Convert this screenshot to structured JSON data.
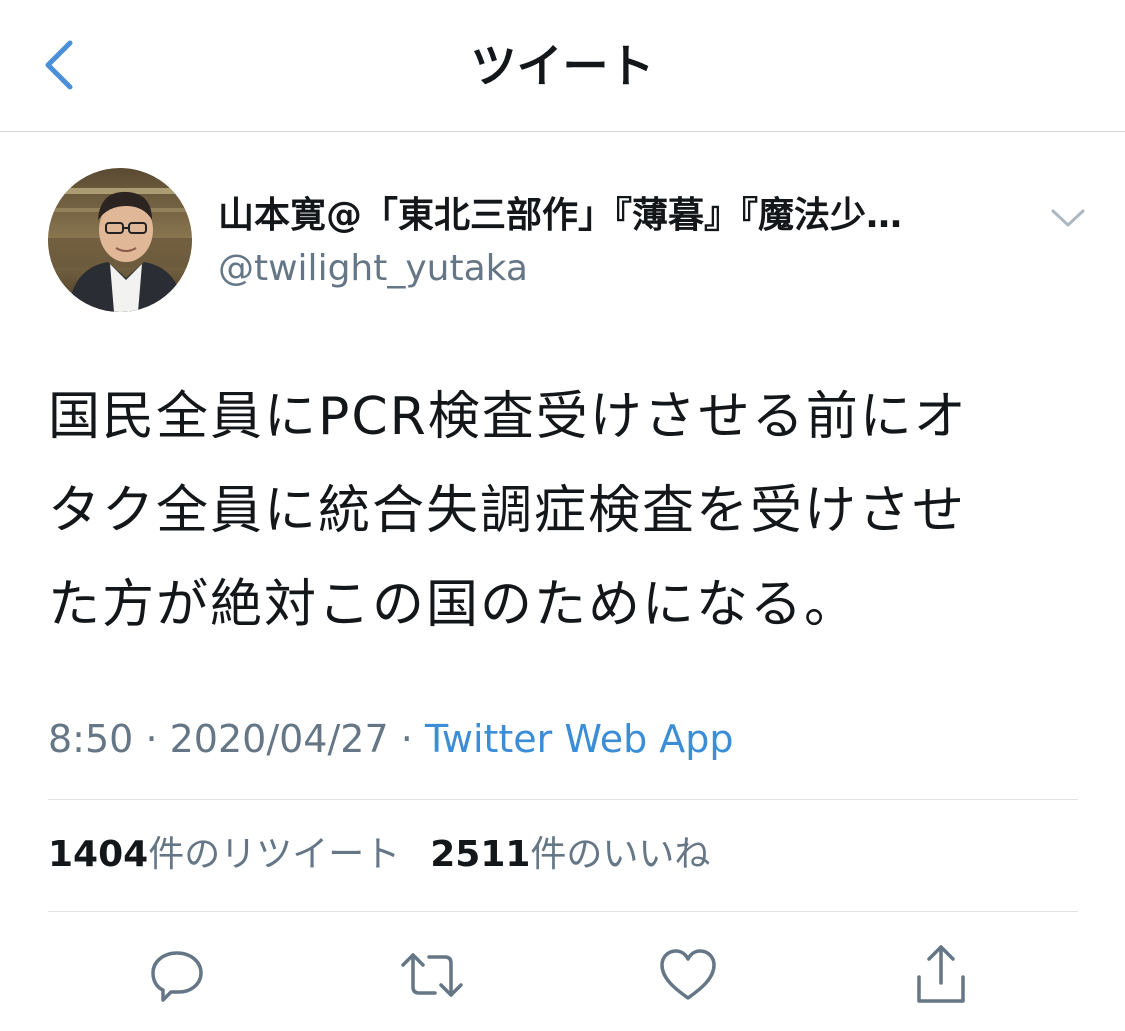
{
  "nav": {
    "title": "ツイート",
    "back_icon": "chevron-left-icon",
    "accent_color": "#4a90d9"
  },
  "author": {
    "name": "山本寛@「東北三部作」『薄暮』『魔法少…",
    "handle": "@twilight_yutaka",
    "menu_icon": "chevron-down-icon"
  },
  "tweet": {
    "lines": [
      "国民全員にPCR検査受けさせる前にオ",
      "タク全員に統合失調症検査を受けさせ",
      "た方が絶対この国のためになる。"
    ]
  },
  "meta": {
    "time": "8:50",
    "separator": "·",
    "date": "2020/04/27",
    "source": "Twitter Web App"
  },
  "stats": {
    "retweets_count": "1404",
    "retweets_label": "件のリツイート",
    "likes_count": "2511",
    "likes_label": "件のいいね"
  },
  "actions": {
    "reply_icon": "reply-icon",
    "retweet_icon": "retweet-icon",
    "like_icon": "heart-icon",
    "share_icon": "share-icon"
  }
}
